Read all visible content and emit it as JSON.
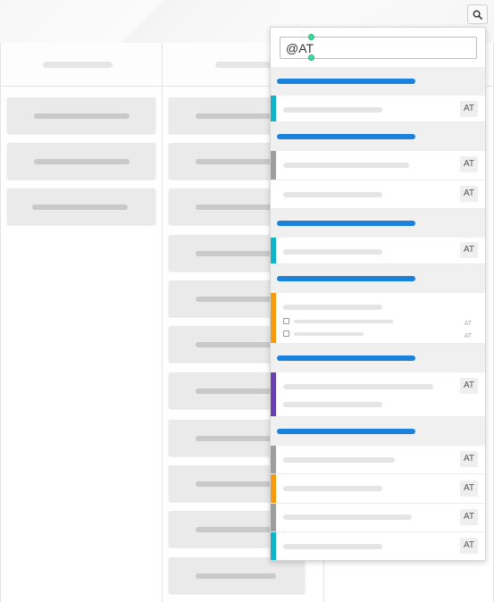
{
  "search": {
    "value": "@AT",
    "button_icon": "search-icon"
  },
  "colors": {
    "group_bar": "#1a82dc",
    "stripe_teal": "#10b4c6",
    "stripe_gray": "#9e9e9e",
    "stripe_orange": "#f59a12",
    "stripe_purple": "#6a3fb0"
  },
  "results": {
    "badge_label": "AT"
  }
}
